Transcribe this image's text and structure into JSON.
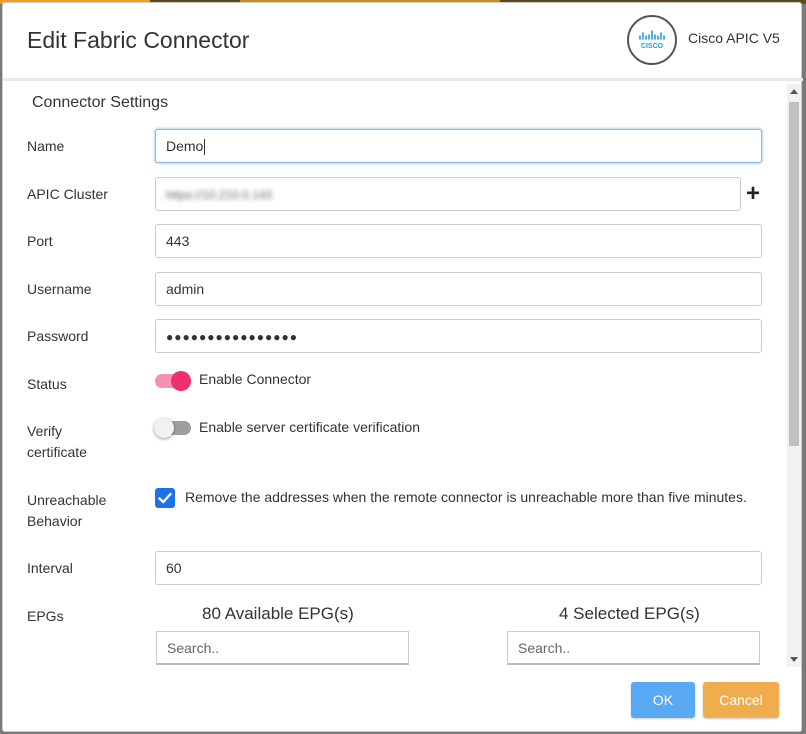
{
  "dialog": {
    "title": "Edit Fabric Connector",
    "vendor_name": "Cisco APIC V5",
    "logo_text": "CISCO"
  },
  "section": {
    "title": "Connector Settings"
  },
  "fields": {
    "name": {
      "label": "Name",
      "value": "Demo"
    },
    "apic_cluster": {
      "label": "APIC Cluster",
      "value": "https://10.210.0.143"
    },
    "port": {
      "label": "Port",
      "value": "443"
    },
    "username": {
      "label": "Username",
      "value": "admin"
    },
    "password": {
      "label": "Password",
      "value": "●●●●●●●●●●●●●●●●"
    },
    "status": {
      "label": "Status",
      "toggle_label": "Enable Connector",
      "enabled": true
    },
    "verify_certificate": {
      "label_line1": "Verify",
      "label_line2": "certificate",
      "toggle_label": "Enable server certificate verification",
      "enabled": false
    },
    "unreachable_behavior": {
      "label_line1": "Unreachable",
      "label_line2": "Behavior",
      "checkbox_label": "Remove the addresses when the remote connector is unreachable more than five minutes.",
      "checked": true
    },
    "interval": {
      "label": "Interval",
      "value": "60"
    },
    "epgs": {
      "label": "EPGs",
      "available_header": "80 Available EPG(s)",
      "selected_header": "4 Selected EPG(s)",
      "available_search_placeholder": "Search..",
      "selected_search_placeholder": "Search.."
    }
  },
  "footer": {
    "ok_label": "OK",
    "cancel_label": "Cancel"
  },
  "colors": {
    "accent_toggle": "#ee2f6c",
    "checkbox": "#1a73e8",
    "ok_button": "#5aa9f4",
    "cancel_button": "#f0ad4e"
  }
}
